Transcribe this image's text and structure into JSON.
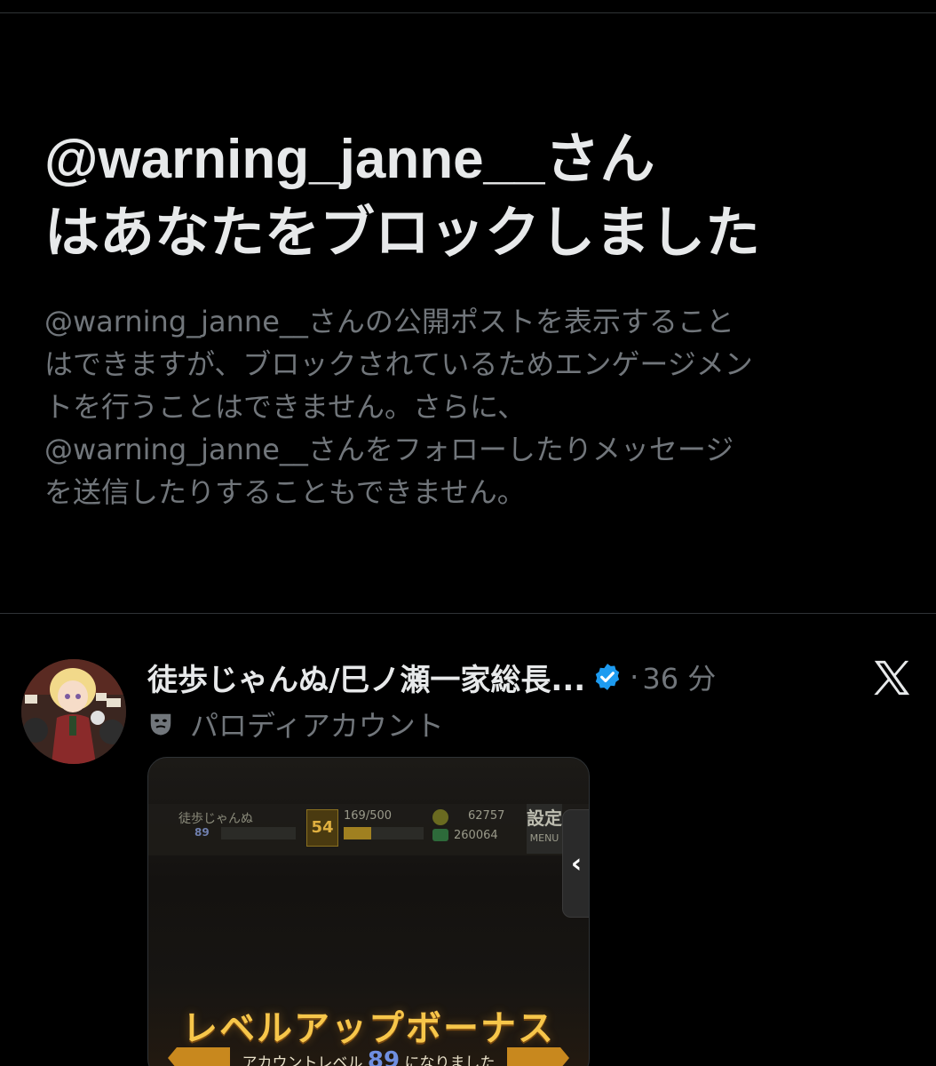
{
  "block_notice": {
    "title_line1": "@warning_janne__さん",
    "title_line2": "はあなたをブロックしました",
    "description_lines": [
      "@warning_janne__さんの公開ポストを表示すること",
      "はできますが、ブロックされているためエンゲージメン",
      "トを行うことはできません。さらに、",
      "@warning_janne__さんをフォローしたりメッセージ",
      "を送信したりすることもできません。"
    ]
  },
  "post": {
    "display_name": "徒歩じゃんぬ/巳ノ瀬一家総長...",
    "separator": "·",
    "time": "36 分",
    "account_label": "パロディアカウント",
    "verified": true,
    "accent_color": "#1d9bf0",
    "media": {
      "hud_name": "徒歩じゃんぬ",
      "hud_level": "89",
      "hud_rank": "54",
      "hud_exp": "169/500",
      "hud_exp_progress": 0.34,
      "hud_coins": "62757",
      "hud_gems": "260064",
      "hud_menu_top": "設定",
      "hud_menu_label": "MENU",
      "side_tab": "‹",
      "banner_title": "レベルアップボーナス",
      "banner_sub_before": "アカウントレベル",
      "banner_sub_level": "89",
      "banner_sub_after": "になりました"
    }
  },
  "icons": {
    "verified": "verified-badge-icon",
    "parody": "theater-mask-icon",
    "brand": "x-logo-icon"
  }
}
